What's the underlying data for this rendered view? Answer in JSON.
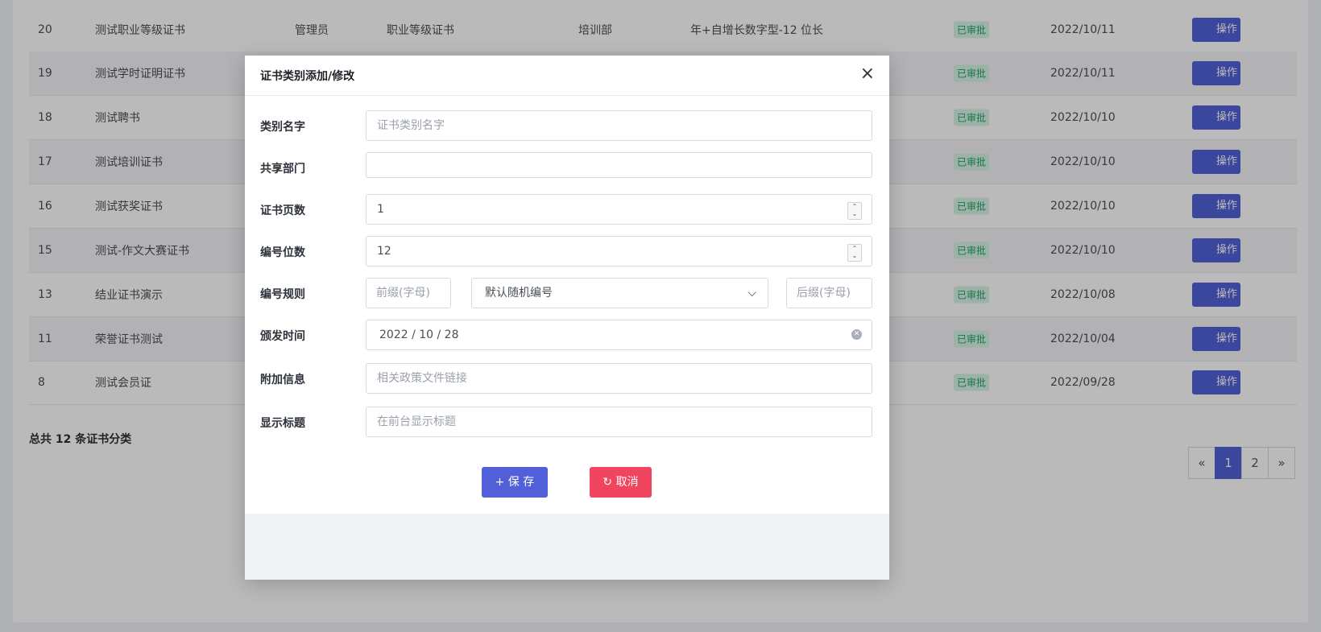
{
  "table": {
    "rows": [
      {
        "id": "20",
        "name": "测试职业等级证书",
        "role": "管理员",
        "category": "职业等级证书",
        "dept": "培训部",
        "rule": "年+自增长数字型-12 位长",
        "status": "已审批",
        "date": "2022/10/11",
        "op": "操作"
      },
      {
        "id": "19",
        "name": "测试学时证明证书",
        "role": "",
        "category": "",
        "dept": "",
        "rule": "",
        "status": "已审批",
        "date": "2022/10/11",
        "op": "操作"
      },
      {
        "id": "18",
        "name": "测试聘书",
        "role": "",
        "category": "",
        "dept": "",
        "rule": "",
        "status": "已审批",
        "date": "2022/10/10",
        "op": "操作"
      },
      {
        "id": "17",
        "name": "测试培训证书",
        "role": "",
        "category": "",
        "dept": "",
        "rule": "",
        "status": "已审批",
        "date": "2022/10/10",
        "op": "操作"
      },
      {
        "id": "16",
        "name": "测试获奖证书",
        "role": "",
        "category": "",
        "dept": "",
        "rule": "",
        "status": "已审批",
        "date": "2022/10/10",
        "op": "操作"
      },
      {
        "id": "15",
        "name": "测试-作文大赛证书",
        "role": "",
        "category": "",
        "dept": "",
        "rule": "",
        "status": "已审批",
        "date": "2022/10/10",
        "op": "操作"
      },
      {
        "id": "13",
        "name": "结业证书演示",
        "role": "",
        "category": "",
        "dept": "",
        "rule": "",
        "status": "已审批",
        "date": "2022/10/08",
        "op": "操作"
      },
      {
        "id": "11",
        "name": "荣誉证书测试",
        "role": "",
        "category": "",
        "dept": "",
        "rule": "",
        "status": "已审批",
        "date": "2022/10/04",
        "op": "操作"
      },
      {
        "id": "8",
        "name": "测试会员证",
        "role": "",
        "category": "",
        "dept": "",
        "rule": "",
        "status": "已审批",
        "date": "2022/09/28",
        "op": "操作"
      }
    ],
    "total_text": "总共 12 条证书分类"
  },
  "pagination": {
    "prev": "«",
    "pages": [
      "1",
      "2"
    ],
    "next": "»",
    "current": "1"
  },
  "modal": {
    "title": "证书类别添加/修改",
    "close_icon": "×",
    "fields": {
      "name": {
        "label": "类别名字",
        "placeholder": "证书类别名字",
        "value": ""
      },
      "shared_dept": {
        "label": "共享部门",
        "value": ""
      },
      "page_count": {
        "label": "证书页数",
        "value": "1"
      },
      "number_digits": {
        "label": "编号位数",
        "value": "12"
      },
      "number_rule": {
        "label": "编号规则",
        "prefix_placeholder": "前缀(字母)",
        "select_value": "默认随机编号",
        "suffix_placeholder": "后缀(字母)"
      },
      "issue_date": {
        "label": "颁发时间",
        "value": "2022 / 10 / 28"
      },
      "extra_info": {
        "label": "附加信息",
        "placeholder": "相关政策文件链接"
      },
      "display_title": {
        "label": "显示标题",
        "placeholder": "在前台显示标题"
      }
    },
    "save_label": "+  保 存",
    "cancel_label": "取消",
    "cancel_icon": "↻"
  },
  "colors": {
    "primary": "#5160d8",
    "danger": "#f0445f",
    "approved": "#21a265"
  }
}
